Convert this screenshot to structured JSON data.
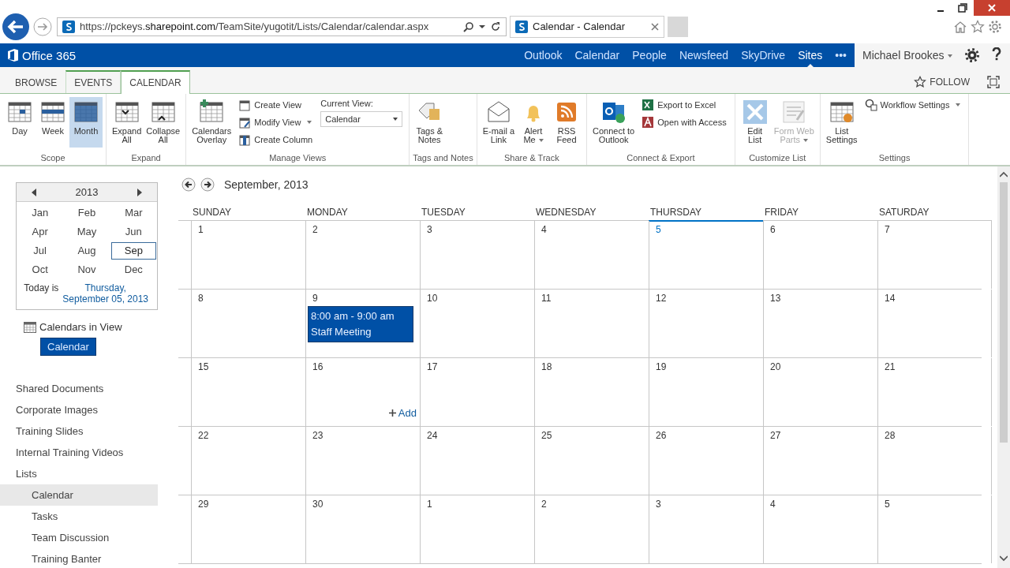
{
  "browser": {
    "url": "https://pckeys.**sharepoint.com**/TeamSite/yugotit/Lists/Calendar/calendar.aspx",
    "tab_title": "Calendar - Calendar"
  },
  "suite_bar": {
    "brand": "Office 365",
    "links": [
      {
        "label": "Outlook",
        "selected": false
      },
      {
        "label": "Calendar",
        "selected": false
      },
      {
        "label": "People",
        "selected": false
      },
      {
        "label": "Newsfeed",
        "selected": false
      },
      {
        "label": "SkyDrive",
        "selected": false
      },
      {
        "label": "Sites",
        "selected": true
      },
      {
        "label": "•••",
        "selected": false
      }
    ],
    "user": "Michael Brookes"
  },
  "ribbon_tabs": [
    {
      "label": "BROWSE",
      "selected": false
    },
    {
      "label": "EVENTS",
      "selected": false
    },
    {
      "label": "CALENDAR",
      "selected": true
    }
  ],
  "follow": "FOLLOW",
  "ribbon": {
    "groups": [
      {
        "label": "Scope",
        "large": [
          {
            "label": "Day",
            "selected": false,
            "disabled": false,
            "dropdown": false
          },
          {
            "label": "Week",
            "selected": false,
            "disabled": false,
            "dropdown": false
          },
          {
            "label": "Month",
            "selected": true,
            "disabled": false,
            "dropdown": false
          }
        ]
      },
      {
        "label": "Expand",
        "large": [
          {
            "label": "Expand\nAll",
            "selected": false,
            "disabled": false,
            "dropdown": false
          },
          {
            "label": "Collapse\nAll",
            "selected": false,
            "disabled": false,
            "dropdown": false
          }
        ]
      },
      {
        "label": "Manage Views",
        "large": [
          {
            "label": "Calendars\nOverlay",
            "selected": false,
            "disabled": false,
            "dropdown": false
          }
        ],
        "small": [
          {
            "label": "Create View",
            "dropdown": false
          },
          {
            "label": "Modify View",
            "dropdown": true
          },
          {
            "label": "Create Column",
            "dropdown": false
          }
        ],
        "view_select": {
          "label": "Current View:",
          "value": "Calendar"
        }
      },
      {
        "label": "Tags and Notes",
        "large": [
          {
            "label": "Tags &\nNotes",
            "selected": false,
            "disabled": false,
            "dropdown": false
          }
        ]
      },
      {
        "label": "Share & Track",
        "large": [
          {
            "label": "E-mail a\nLink",
            "selected": false,
            "disabled": false,
            "dropdown": false
          },
          {
            "label": "Alert\nMe",
            "selected": false,
            "disabled": false,
            "dropdown": true
          },
          {
            "label": "RSS\nFeed",
            "selected": false,
            "disabled": false,
            "dropdown": false
          }
        ]
      },
      {
        "label": "Connect & Export",
        "large": [
          {
            "label": "Connect to\nOutlook",
            "selected": false,
            "disabled": false,
            "dropdown": false
          }
        ],
        "small": [
          {
            "label": "Export to Excel",
            "dropdown": false
          },
          {
            "label": "Open with Access",
            "dropdown": false
          }
        ]
      },
      {
        "label": "Customize List",
        "large": [
          {
            "label": "Edit\nList",
            "selected": false,
            "disabled": false,
            "dropdown": false
          },
          {
            "label": "Form Web\nParts",
            "selected": false,
            "disabled": true,
            "dropdown": true
          }
        ]
      },
      {
        "label": "Settings",
        "large": [
          {
            "label": "List\nSettings",
            "selected": false,
            "disabled": false,
            "dropdown": false
          }
        ],
        "small": [
          {
            "label": "Workflow Settings",
            "dropdown": true
          }
        ]
      }
    ]
  },
  "date_picker": {
    "year": "2013",
    "months": [
      {
        "label": "Jan",
        "selected": false
      },
      {
        "label": "Feb",
        "selected": false
      },
      {
        "label": "Mar",
        "selected": false
      },
      {
        "label": "Apr",
        "selected": false
      },
      {
        "label": "May",
        "selected": false
      },
      {
        "label": "Jun",
        "selected": false
      },
      {
        "label": "Jul",
        "selected": false
      },
      {
        "label": "Aug",
        "selected": false
      },
      {
        "label": "Sep",
        "selected": true
      },
      {
        "label": "Oct",
        "selected": false
      },
      {
        "label": "Nov",
        "selected": false
      },
      {
        "label": "Dec",
        "selected": false
      }
    ],
    "today_label": "Today is",
    "today_link": "Thursday, September 05, 2013"
  },
  "calendars_in_view": {
    "label": "Calendars in View",
    "items": [
      "Calendar"
    ]
  },
  "nav": [
    {
      "label": "Shared Documents",
      "selected": false
    },
    {
      "label": "Corporate Images",
      "selected": false
    },
    {
      "label": "Training Slides",
      "selected": false
    },
    {
      "label": "Internal Training Videos",
      "selected": false
    },
    {
      "label": "Lists",
      "selected": false,
      "children": [
        {
          "label": "Calendar",
          "selected": true
        },
        {
          "label": "Tasks",
          "selected": false
        },
        {
          "label": "Team Discussion",
          "selected": false
        },
        {
          "label": "Training Banter",
          "selected": false
        }
      ]
    }
  ],
  "calendar": {
    "title": "September, 2013",
    "days": [
      {
        "label": "SUNDAY",
        "today": false
      },
      {
        "label": "MONDAY",
        "today": false
      },
      {
        "label": "TUESDAY",
        "today": false
      },
      {
        "label": "WEDNESDAY",
        "today": false
      },
      {
        "label": "THURSDAY",
        "today": true
      },
      {
        "label": "FRIDAY",
        "today": false
      },
      {
        "label": "SATURDAY",
        "today": false
      }
    ],
    "weeks": [
      [
        {
          "date": "1",
          "today": false
        },
        {
          "date": "2",
          "today": false
        },
        {
          "date": "3",
          "today": false
        },
        {
          "date": "4",
          "today": false
        },
        {
          "date": "5",
          "today": true
        },
        {
          "date": "6",
          "today": false
        },
        {
          "date": "7",
          "today": false
        }
      ],
      [
        {
          "date": "8",
          "today": false
        },
        {
          "date": "9",
          "today": false,
          "events": [
            {
              "time": "8:00 am - 9:00 am",
              "title": "Staff Meeting"
            }
          ]
        },
        {
          "date": "10",
          "today": false
        },
        {
          "date": "11",
          "today": false
        },
        {
          "date": "12",
          "today": false
        },
        {
          "date": "13",
          "today": false
        },
        {
          "date": "14",
          "today": false
        }
      ],
      [
        {
          "date": "15",
          "today": false
        },
        {
          "date": "16",
          "today": false,
          "add": "Add"
        },
        {
          "date": "17",
          "today": false
        },
        {
          "date": "18",
          "today": false
        },
        {
          "date": "19",
          "today": false
        },
        {
          "date": "20",
          "today": false
        },
        {
          "date": "21",
          "today": false
        }
      ],
      [
        {
          "date": "22",
          "today": false
        },
        {
          "date": "23",
          "today": false
        },
        {
          "date": "24",
          "today": false
        },
        {
          "date": "25",
          "today": false
        },
        {
          "date": "26",
          "today": false
        },
        {
          "date": "27",
          "today": false
        },
        {
          "date": "28",
          "today": false
        }
      ],
      [
        {
          "date": "29",
          "today": false
        },
        {
          "date": "30",
          "today": false
        },
        {
          "date": "1",
          "today": false
        },
        {
          "date": "2",
          "today": false
        },
        {
          "date": "3",
          "today": false
        },
        {
          "date": "4",
          "today": false
        },
        {
          "date": "5",
          "today": false
        }
      ]
    ]
  }
}
